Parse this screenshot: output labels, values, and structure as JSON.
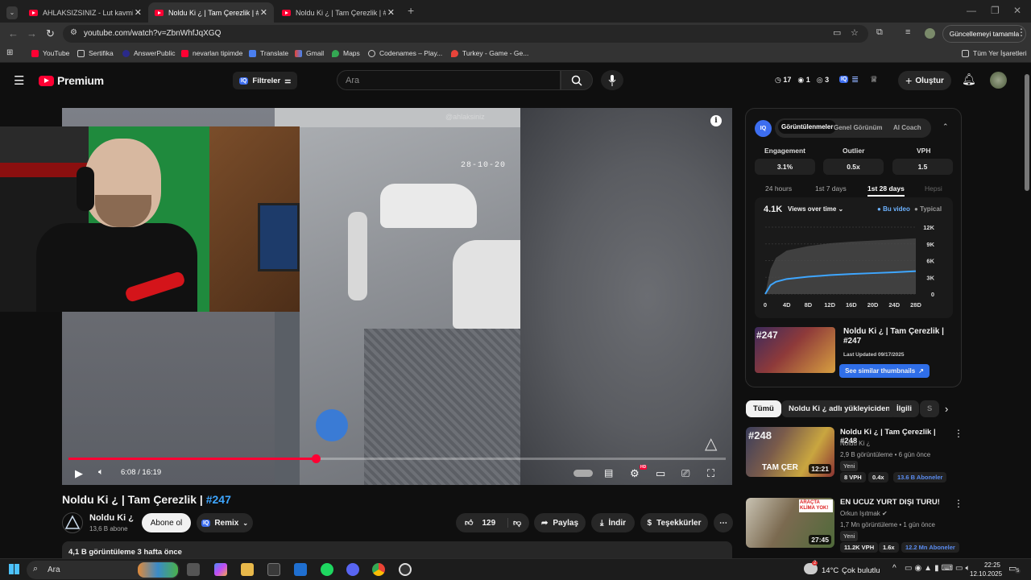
{
  "browser": {
    "tabs": [
      {
        "label": "AHLAKSIZSINIZ - Lut kavminde"
      },
      {
        "label": "Noldu Ki ¿ | Tam Çerezlik | #247"
      },
      {
        "label": "Noldu Ki ¿ | Tam Çerezlik | #248"
      }
    ],
    "url": "youtube.com/watch?v=ZbnWhfJqXGQ",
    "update_label": "Güncellemeyi tamamla",
    "bookmarks": [
      "YouTube",
      "Sertifika",
      "AnswerPublic",
      "nevarlan tipimde",
      "Translate",
      "Gmail",
      "Maps",
      "Codenames – Play...",
      "Turkey - Game - Ge..."
    ],
    "all_bookmarks": "Tüm Yer İşaretleri"
  },
  "header": {
    "logo": "Premium",
    "filters": "Filtreler",
    "search_placeholder": "Ara",
    "counter_a": "17",
    "counter_b": "1",
    "counter_c": "3",
    "create": "Oluştur",
    "colors": {
      "brand": "#ff0033",
      "link": "#3ea6ff",
      "iq": "#3d6ef0"
    }
  },
  "player": {
    "watermark": "@ahlaksiniz",
    "timestamp": "28-10-20",
    "time": "6:08 / 16:19",
    "progress_fraction": 0.376,
    "settings_badge": "HD"
  },
  "video": {
    "title_main": "Noldu Ki ¿ | Tam Çerezlik | ",
    "title_hash": "#247",
    "channel": "Noldu Ki ¿",
    "subs": "13,6 B abone",
    "subscribe": "Abone ol",
    "remix": "Remix",
    "likes": "129",
    "share": "Paylaş",
    "download": "İndir",
    "thanks": "Teşekkürler",
    "views": "4,1 B görüntüleme",
    "ago": "3 hafta önce"
  },
  "panel": {
    "tabs": [
      "Görüntülenmeler",
      "Genel Görünüm",
      "AI Coach"
    ],
    "metrics": [
      {
        "label": "Engagement",
        "value": "3.1%"
      },
      {
        "label": "Outlier",
        "value": "0.5x"
      },
      {
        "label": "VPH",
        "value": "1.5"
      }
    ],
    "ranges": [
      "24 hours",
      "1st 7 days",
      "1st 28 days",
      "Hepsi"
    ],
    "views_total": "4.1K",
    "views_selector": "Views over time",
    "legend": [
      "Bu video",
      "Typical"
    ],
    "card_title": "Noldu Ki ¿ | Tam Çerezlik | #247",
    "card_updated": "Last Updated 09/17/2025",
    "card_button": "See similar thumbnails"
  },
  "chart_data": {
    "type": "area",
    "x_ticks": [
      "0",
      "4D",
      "8D",
      "12D",
      "16D",
      "20D",
      "24D",
      "28D"
    ],
    "y_ticks": [
      "0",
      "3K",
      "6K",
      "9K",
      "12K"
    ],
    "ylim": [
      0,
      12000
    ],
    "series": [
      {
        "name": "Bu video",
        "x": [
          0,
          1,
          2,
          4,
          8,
          12,
          16,
          20,
          24,
          28
        ],
        "values": [
          0,
          1600,
          2200,
          2700,
          3100,
          3400,
          3600,
          3750,
          3900,
          4100
        ]
      },
      {
        "name": "Typical",
        "x": [
          0,
          1,
          2,
          4,
          8,
          12,
          16,
          20,
          24,
          28
        ],
        "values": [
          0,
          4500,
          6500,
          7800,
          8600,
          9100,
          9400,
          9600,
          9800,
          10000
        ]
      }
    ]
  },
  "chips": [
    "Tümü",
    "Noldu Ki ¿ adlı yükleyiciden",
    "İlgili",
    "S"
  ],
  "related": [
    {
      "title": "Noldu Ki ¿ | Tam Çerezlik | #248",
      "channel": "Noldu Ki ¿",
      "meta": "2,9 B görüntüleme • 6 gün önce",
      "badge": "Yeni",
      "duration": "12:21",
      "vph": "8 VPH",
      "mult": "0.4x",
      "subs": "13.6 B Aboneler",
      "thumb_text": "#248",
      "thumb_sub": "TAM ÇER"
    },
    {
      "title": "EN UCUZ YURT DIŞI TURU!",
      "channel": "Orkun Işıtmak",
      "meta": "1,7 Mn görüntüleme • 1 gün önce",
      "badge": "Yeni",
      "duration": "27:45",
      "vph": "11.2K VPH",
      "mult": "1.6x",
      "subs": "12.2 Mn Aboneler",
      "thumb_text": "ARAÇTA KLİMA YOK!"
    }
  ],
  "taskbar": {
    "search": "Ara",
    "weather_temp": "14°C",
    "weather_desc": "Çok bulutlu",
    "time": "22:25",
    "date": "12.10.2025",
    "notif": "5",
    "weather_badge": "2"
  }
}
